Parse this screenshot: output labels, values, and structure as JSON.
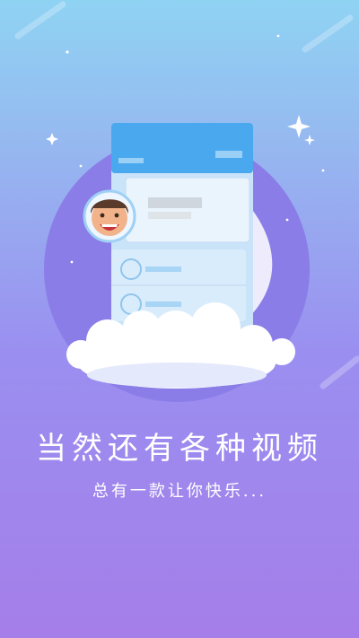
{
  "splash": {
    "headline": "当然还有各种视频",
    "subline": "总有一款让你快乐..."
  },
  "colors": {
    "bg_top": "#8fd3f3",
    "bg_bottom": "#a57ee9",
    "circle": "#8a7de8",
    "card_header": "#4aa9ee",
    "card_body": "#d9ecfb"
  },
  "icons": [
    "sparkle-star-icon",
    "avatar-face-icon",
    "cloud-icon"
  ]
}
